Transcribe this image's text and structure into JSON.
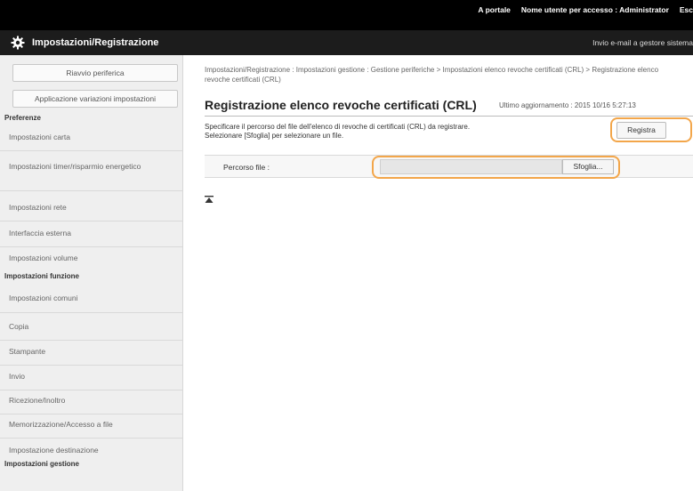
{
  "header": {
    "portal_link": "A portale",
    "login_user": "Nome utente per accesso : Administrator",
    "logout_link": "Esc"
  },
  "titlebar": {
    "title": "Impostazioni/Registrazione",
    "mail_note": "Invio e-mail a gestore sistema"
  },
  "sidebar": {
    "restart_button": "Riavvio periferica",
    "apply_button": "Applicazione variazioni impostazioni",
    "sections": [
      {
        "heading": "Preferenze"
      },
      {
        "heading": "Impostazioni funzione"
      },
      {
        "heading": "Impostazioni gestione"
      }
    ],
    "items": [
      "Impostazioni carta",
      "Impostazioni timer/risparmio energetico",
      "Impostazioni rete",
      "Interfaccia esterna",
      "Impostazioni volume",
      "Impostazioni comuni",
      "Copia",
      "Stampante",
      "Invio",
      "Ricezione/Inoltro",
      "Memorizzazione/Accesso a file",
      "Impostazione destinazione"
    ]
  },
  "main": {
    "breadcrumb": "Impostazioni/Registrazione : Impostazioni gestione : Gestione periferiche > Impostazioni elenco revoche certificati (CRL) > Registrazione elenco revoche certificati (CRL)",
    "page_title": "Registrazione elenco revoche certificati (CRL)",
    "last_update": "Ultimo aggiornamento : 2015 10/16 5:27:13",
    "instruction_1": "Specificare il percorso del file dell'elenco di revoche di certificati (CRL) da registrare.",
    "instruction_2": "Selezionare [Sfoglia] per selezionare un file.",
    "register_button": "Registra",
    "file_path_label": "Percorso file :",
    "file_path_value": "",
    "browse_button": "Sfoglia...",
    "highlight_color": "#f3a64a"
  }
}
